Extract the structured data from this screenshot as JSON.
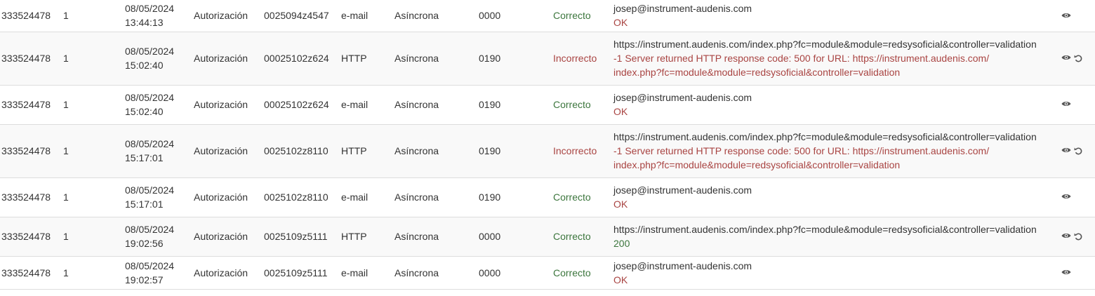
{
  "rows": [
    {
      "merchant": "333524478",
      "terminal": "1",
      "date": "08/05/2024",
      "time": "13:44:13",
      "type": "Autorización",
      "order": "0025094z4547",
      "channel": "e-mail",
      "mode": "Asíncrona",
      "code": "0000",
      "status": "Correcto",
      "status_kind": "ok",
      "dest": "josep@instrument-audenis.com",
      "response": "OK",
      "response_kind": "red",
      "retry": false
    },
    {
      "merchant": "333524478",
      "terminal": "1",
      "date": "08/05/2024",
      "time": "15:02:40",
      "type": "Autorización",
      "order": "00025102z624",
      "channel": "HTTP",
      "mode": "Asíncrona",
      "code": "0190",
      "status": "Incorrecto",
      "status_kind": "bad",
      "dest": "https://instrument.audenis.com/index.php?fc=module&module=redsysoficial&controller=validation",
      "response": "-1 Server returned HTTP response code: 500 for URL: https://instrument.audenis.com/",
      "response2": "index.php?fc=module&module=redsysoficial&controller=validation",
      "response_kind": "red",
      "retry": true
    },
    {
      "merchant": "333524478",
      "terminal": "1",
      "date": "08/05/2024",
      "time": "15:02:40",
      "type": "Autorización",
      "order": "00025102z624",
      "channel": "e-mail",
      "mode": "Asíncrona",
      "code": "0190",
      "status": "Correcto",
      "status_kind": "ok",
      "dest": "josep@instrument-audenis.com",
      "response": "OK",
      "response_kind": "red",
      "retry": false
    },
    {
      "merchant": "333524478",
      "terminal": "1",
      "date": "08/05/2024",
      "time": "15:17:01",
      "type": "Autorización",
      "order": "0025102z8110",
      "channel": "HTTP",
      "mode": "Asíncrona",
      "code": "0190",
      "status": "Incorrecto",
      "status_kind": "bad",
      "dest": "https://instrument.audenis.com/index.php?fc=module&module=redsysoficial&controller=validation",
      "response": "-1 Server returned HTTP response code: 500 for URL: https://instrument.audenis.com/",
      "response2": "index.php?fc=module&module=redsysoficial&controller=validation",
      "response_kind": "red",
      "retry": true
    },
    {
      "merchant": "333524478",
      "terminal": "1",
      "date": "08/05/2024",
      "time": "15:17:01",
      "type": "Autorización",
      "order": "0025102z8110",
      "channel": "e-mail",
      "mode": "Asíncrona",
      "code": "0190",
      "status": "Correcto",
      "status_kind": "ok",
      "dest": "josep@instrument-audenis.com",
      "response": "OK",
      "response_kind": "red",
      "retry": false
    },
    {
      "merchant": "333524478",
      "terminal": "1",
      "date": "08/05/2024",
      "time": "19:02:56",
      "type": "Autorización",
      "order": "0025109z5111",
      "channel": "HTTP",
      "mode": "Asíncrona",
      "code": "0000",
      "status": "Correcto",
      "status_kind": "ok",
      "dest": "https://instrument.audenis.com/index.php?fc=module&module=redsysoficial&controller=validation",
      "response": "200",
      "response_kind": "green",
      "retry": true
    },
    {
      "merchant": "333524478",
      "terminal": "1",
      "date": "08/05/2024",
      "time": "19:02:57",
      "type": "Autorización",
      "order": "0025109z5111",
      "channel": "e-mail",
      "mode": "Asíncrona",
      "code": "0000",
      "status": "Correcto",
      "status_kind": "ok",
      "dest": "josep@instrument-audenis.com",
      "response": "OK",
      "response_kind": "red",
      "retry": false
    }
  ],
  "icons": {
    "view": "eye-icon",
    "retry": "retry-icon"
  },
  "colors": {
    "ok": "#3c763d",
    "error": "#a94442",
    "border": "#dddddd",
    "stripe": "#f9f9f9"
  }
}
